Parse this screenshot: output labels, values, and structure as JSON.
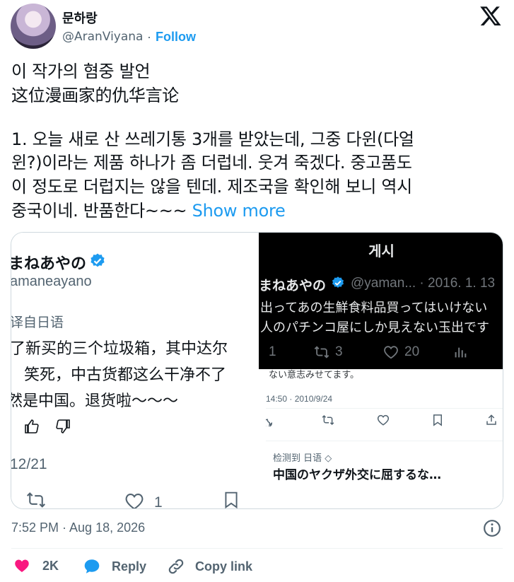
{
  "header": {
    "display_name": "문하랑",
    "handle": "@AranViyana",
    "dot": "·",
    "follow_label": "Follow"
  },
  "tweet": {
    "lines": [
      "이 작가의 혐중 발언",
      "这位漫画家的仇华言论",
      "1. 오늘 새로 산 쓰레기통 3개를 받았는데, 그중 다윈(다얼",
      "윈?)이라는 제품 하나가 좀 더럽네. 웃겨 죽겠다. 중고품도",
      "이 정도로 더럽지는 않을 텐데. 제조국을 확인해 보니 역시",
      "중국이네. 반품한다~~~ "
    ],
    "show_more": "Show more"
  },
  "left_shot": {
    "name": "まねあやの",
    "handle": "amaneayano",
    "translate_label": "译自日语",
    "lines": [
      "了新买的三个垃圾箱，其中达尔",
      "笑死，中古货都这么干净不了",
      "然是中国。退货啦～～～"
    ],
    "date": "12/21",
    "like_count": "1"
  },
  "right_shot": {
    "dark": {
      "title": "게시",
      "name": "まねあやの",
      "handle_date": "@yaman... · 2016. 1. 13",
      "lines": [
        "出ってあの生鮮食料品買ってはいけない",
        "人のパチンコ屋にしか見えない玉出です"
      ],
      "reply_count": "1",
      "retweet_count": "3",
      "like_count": "20"
    },
    "peek_text": "ない意志みせてます。",
    "timestamp": "14:50 · 2010/9/24",
    "detected_label": "检测到 日语 ◇",
    "translated_line": "中国のヤクザ外交に屈するな…"
  },
  "footer": {
    "timestamp": "7:52 PM · Aug 18, 2026",
    "like_count": "2K",
    "reply_label": "Reply",
    "copy_link_label": "Copy link"
  },
  "colors": {
    "accent": "#1d9bf0",
    "like": "#f91880",
    "muted": "#536471",
    "verified": "#1d9bf0"
  }
}
